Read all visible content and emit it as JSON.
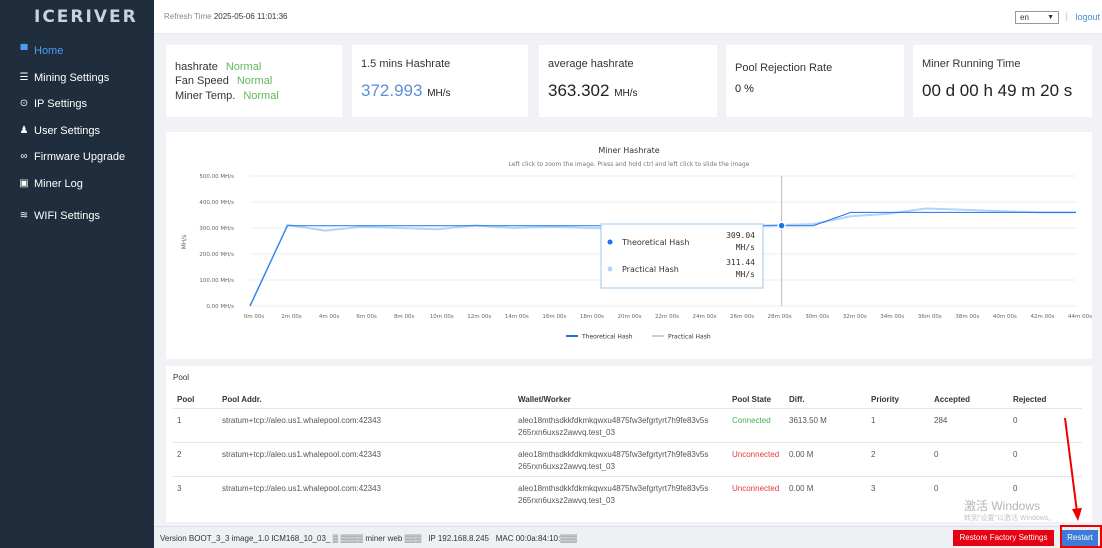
{
  "brand": "ICERIVER",
  "sidebar": {
    "items": [
      {
        "label": "Home",
        "icon": "monitor-icon",
        "active": true
      },
      {
        "label": "Mining Settings",
        "icon": "list-icon"
      },
      {
        "label": "IP Settings",
        "icon": "location-pin-icon"
      },
      {
        "label": "User Settings",
        "icon": "user-icon"
      },
      {
        "label": "Firmware Upgrade",
        "icon": "link-icon"
      },
      {
        "label": "Miner Log",
        "icon": "log-icon"
      },
      {
        "label": "WIFI Settings",
        "icon": "wifi-icon"
      }
    ]
  },
  "topbar": {
    "refresh_label": "Refresh Time",
    "refresh_time": "2025-05-06 11:01:36",
    "lang": "en",
    "sep": "|",
    "logout": "logout"
  },
  "cards": {
    "status": {
      "hashrate_label": "hashrate",
      "hashrate_value": "Normal",
      "fan_label": "Fan Speed",
      "fan_value": "Normal",
      "temp_label": "Miner Temp.",
      "temp_value": "Normal"
    },
    "hash15": {
      "title": "1.5 mins Hashrate",
      "value": "372.993",
      "unit": "MH/s"
    },
    "avg": {
      "title": "average hashrate",
      "value": "363.302",
      "unit": "MH/s"
    },
    "reject": {
      "title": "Pool Rejection Rate",
      "value": "0 %"
    },
    "runtime": {
      "title": "Miner Running Time",
      "value": "00 d 00 h 49 m 20 s"
    }
  },
  "chart_data": {
    "type": "line",
    "title": "Miner Hashrate",
    "subtitle": "Left click to zoom the image. Press and hold ctrl and left click to slide the image",
    "ylabel": "MH/s",
    "ylim": [
      0,
      500
    ],
    "yticks": [
      "0.00 MH/s",
      "100.00 MH/s",
      "200.00 MH/s",
      "300.00 MH/s",
      "400.00 MH/s",
      "500.00 MH/s"
    ],
    "categories": [
      "0m 00s",
      "2m 00s",
      "4m 00s",
      "6m 00s",
      "8m 00s",
      "10m 00s",
      "12m 00s",
      "14m 00s",
      "16m 00s",
      "18m 00s",
      "20m 00s",
      "22m 00s",
      "24m 00s",
      "26m 00s",
      "28m 00s",
      "30m 00s",
      "32m 00s",
      "34m 00s",
      "36m 00s",
      "38m 00s",
      "40m 00s",
      "42m 00s",
      "44m 00s"
    ],
    "series": [
      {
        "name": "Theoretical Hash",
        "color": "#1a73e8",
        "values": [
          0,
          309,
          309,
          309,
          309,
          309,
          309,
          309,
          309,
          309,
          309,
          309,
          309,
          309,
          309,
          309,
          360,
          360,
          360,
          360,
          360,
          360,
          360
        ]
      },
      {
        "name": "Practical Hash",
        "color": "#b3d4f5",
        "values": [
          0,
          312,
          290,
          305,
          300,
          295,
          310,
          300,
          305,
          300,
          298,
          312,
          300,
          305,
          311,
          315,
          345,
          355,
          375,
          370,
          365,
          360,
          360
        ]
      }
    ],
    "legend": "bottom",
    "tooltip": {
      "series": [
        "Theoretical Hash",
        "Practical Hash"
      ],
      "values": [
        "309.04 MH/s",
        "311.44 MH/s"
      ]
    }
  },
  "pool": {
    "title": "Pool",
    "headers": [
      "Pool",
      "Pool Addr.",
      "Wallet/Worker",
      "Pool State",
      "Diff.",
      "Priority",
      "Accepted",
      "Rejected"
    ],
    "rows": [
      {
        "pool": "1",
        "addr": "stratum+tcp://aleo.us1.whalepool.com:42343",
        "wallet1": "aleo18mthsdkkfdkmkqwxu4875fw3efgrtyrt7h9fe83v5s",
        "wallet2": "265rxn6uxsz2awvq.test_03",
        "state": "Connected",
        "diff": "3613.50 M",
        "priority": "1",
        "accepted": "284",
        "rejected": "0"
      },
      {
        "pool": "2",
        "addr": "stratum+tcp://aleo.us1.whalepool.com:42343",
        "wallet1": "aleo18mthsdkkfdkmkqwxu4875fw3efgrtyrt7h9fe83v5s",
        "wallet2": "265rxn6uxsz2awvq.test_03",
        "state": "Unconnected",
        "diff": "0.00 M",
        "priority": "2",
        "accepted": "0",
        "rejected": "0"
      },
      {
        "pool": "3",
        "addr": "stratum+tcp://aleo.us1.whalepool.com:42343",
        "wallet1": "aleo18mthsdkkfdkmkqwxu4875fw3efgrtyrt7h9fe83v5s",
        "wallet2": "265rxn6uxsz2awvq.test_03",
        "state": "Unconnected",
        "diff": "0.00 M",
        "priority": "3",
        "accepted": "0",
        "rejected": "0"
      }
    ]
  },
  "footer": {
    "version_label": "Version",
    "version": "BOOT_3_3 image_1.0 ICM168_10_03_",
    "miner_web": "miner web",
    "ip_label": "IP",
    "ip": "192.168.8.245",
    "mac_label": "MAC",
    "mac": "00:0a:84:10:",
    "restore": "Restore Factory Settings",
    "restart": "Restart"
  },
  "watermark": {
    "line1": "激活 Windows",
    "line2": "转到\"设置\"以激活 Windows。"
  }
}
